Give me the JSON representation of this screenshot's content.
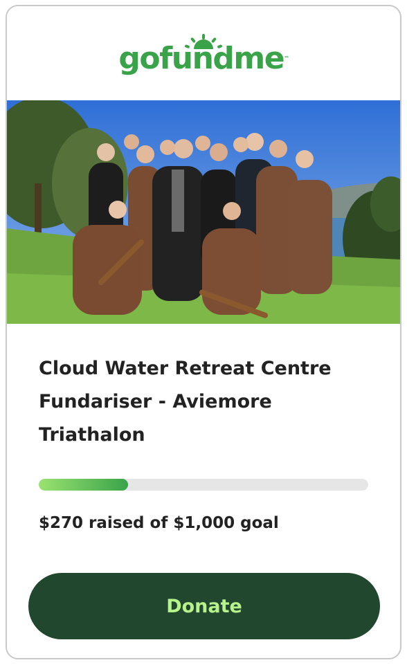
{
  "brand": {
    "name": "gofundme",
    "tm": "™",
    "color": "#3aa34a"
  },
  "campaign": {
    "title": "Cloud Water Retreat Centre Fundariser - Aviemore Triathalon",
    "raised_text": "$270 raised of $1,000 goal",
    "progress_fraction": 0.27
  },
  "cta": {
    "donate_label": "Donate",
    "bg": "#22472f",
    "fg": "#b8f28a"
  },
  "image": {
    "subject": "group-photo"
  }
}
